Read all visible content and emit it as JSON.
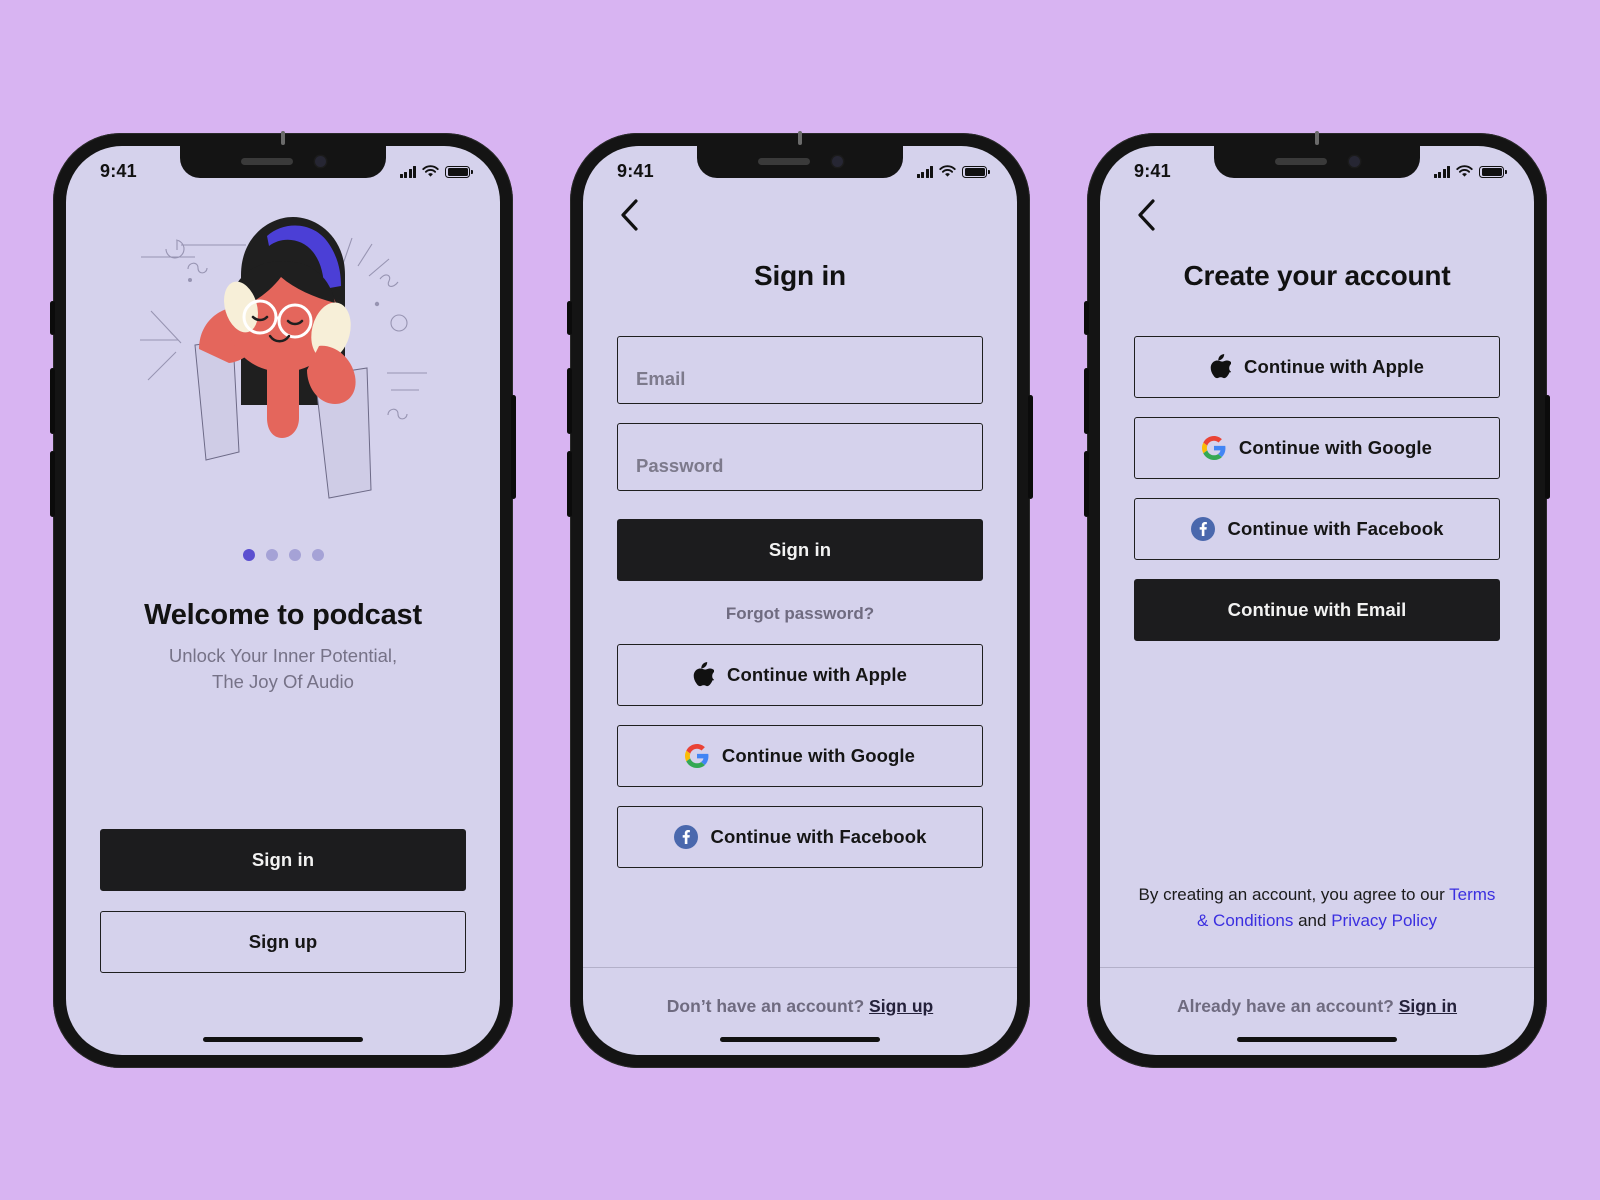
{
  "theme": {
    "page_background": "#D8B4F2",
    "screen_background": "#D5D2EC",
    "primary_dark": "#1C1C1E",
    "link_blue": "#3B2FE0",
    "muted_text": "#6F6B80",
    "dot_active": "#5B4FD0",
    "dot_inactive": "#A5A2D6"
  },
  "status_bar": {
    "time": "9:41",
    "cellular_icon": "signal-bars-icon",
    "wifi_icon": "wifi-icon",
    "battery_icon": "battery-full-icon"
  },
  "screens": [
    {
      "id": "welcome",
      "name": "Welcome to podcast onboarding",
      "illustration": {
        "icon": "woman-with-headphones-illustration",
        "skin": "#E4665C",
        "hair": "#1F1F1F",
        "headband": "#4B3FD6",
        "headphone_cup": "#F7EFD8",
        "sleeve": "#CFCCE6"
      },
      "pager": {
        "total": 4,
        "active_index": 0
      },
      "title": "Welcome to podcast",
      "subtitle_line1": "Unlock Your Inner Potential,",
      "subtitle_line2": "The Joy Of Audio",
      "primary_button": "Sign in",
      "secondary_button": "Sign up"
    },
    {
      "id": "sign-in",
      "name": "Sign in screen",
      "back_icon": "chevron-left-icon",
      "title": "Sign in",
      "fields": [
        {
          "name": "email",
          "placeholder": "Email",
          "value": ""
        },
        {
          "name": "password",
          "placeholder": "Password",
          "value": ""
        }
      ],
      "primary_button": "Sign in",
      "forgot_link": "Forgot password?",
      "social_buttons": [
        {
          "icon": "apple-icon",
          "label": "Continue with Apple"
        },
        {
          "icon": "google-icon",
          "label": "Continue with Google"
        },
        {
          "icon": "facebook-icon",
          "label": "Continue with Facebook"
        }
      ],
      "footer_prefix": "Don’t have an account? ",
      "footer_link": "Sign up"
    },
    {
      "id": "create-account",
      "name": "Create your account screen",
      "back_icon": "chevron-left-icon",
      "title": "Create your account",
      "social_buttons": [
        {
          "icon": "apple-icon",
          "label": "Continue with Apple"
        },
        {
          "icon": "google-icon",
          "label": "Continue with Google"
        },
        {
          "icon": "facebook-icon",
          "label": "Continue with Facebook"
        }
      ],
      "email_button": "Continue with Email",
      "legal_prefix": "By creating an account, you agree to our ",
      "legal_link_terms": "Terms & Conditions",
      "legal_middle": " and ",
      "legal_link_privacy": "Privacy Policy",
      "footer_prefix": "Already have an account? ",
      "footer_link": "Sign in"
    }
  ]
}
